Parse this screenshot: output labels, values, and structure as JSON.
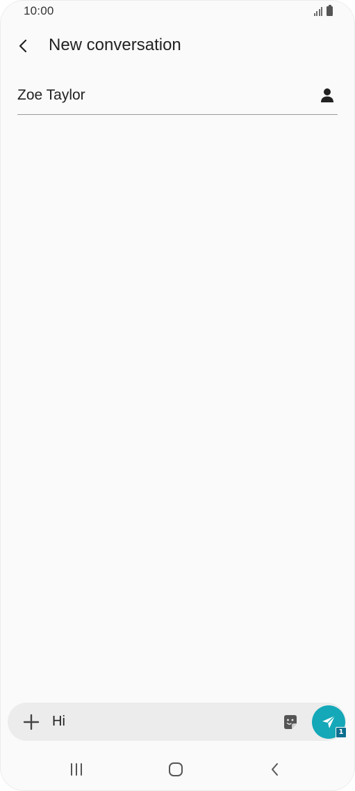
{
  "status_bar": {
    "time": "10:00",
    "icons": [
      "signal-icon",
      "battery-icon"
    ]
  },
  "header": {
    "title": "New conversation",
    "back_icon": "back-arrow-icon"
  },
  "recipient": {
    "value": "Zoe Taylor",
    "contact_icon": "contact-person-icon"
  },
  "composer": {
    "add_icon": "plus-icon",
    "message_value": "Hi",
    "sticker_icon": "sticker-icon",
    "send_icon": "send-icon",
    "sim_badge": "1"
  },
  "nav_bar": {
    "icons": [
      "recent-apps-icon",
      "home-icon",
      "back-icon"
    ]
  },
  "colors": {
    "send_button": "#14a8b8",
    "sim_badge": "#0e6f8f",
    "composer_bg": "#ececec",
    "screen_bg": "#fafafa"
  }
}
